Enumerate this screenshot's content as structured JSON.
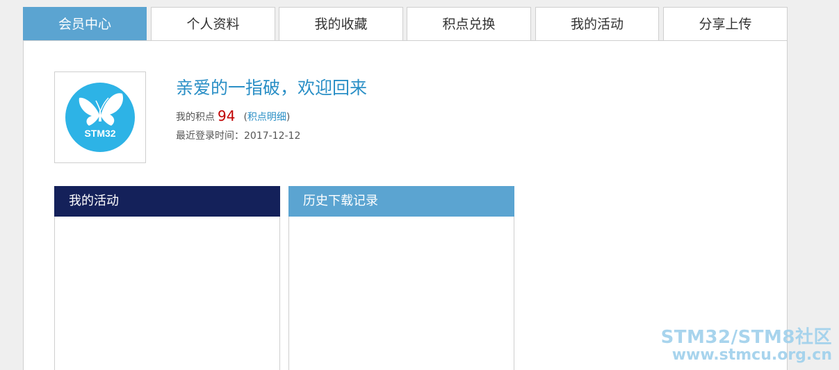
{
  "tabs": [
    {
      "label": "会员中心",
      "active": true
    },
    {
      "label": "个人资料",
      "active": false
    },
    {
      "label": "我的收藏",
      "active": false
    },
    {
      "label": "积点兑换",
      "active": false
    },
    {
      "label": "我的活动",
      "active": false
    },
    {
      "label": "分享上传",
      "active": false
    }
  ],
  "profile": {
    "avatar_text": "STM32",
    "welcome": "亲爱的一指破，欢迎回来",
    "points_label": "我的积点",
    "points_value": "94",
    "points_detail_link": "积点明细",
    "last_login_label": "最近登录时间：",
    "last_login_value": "2017-12-12"
  },
  "panels": {
    "activities_title": "我的活动",
    "downloads_title": "历史下载记录"
  },
  "watermark": {
    "line1": "STM32/STM8社区",
    "line2": "www.stmcu.org.cn"
  },
  "colors": {
    "accent": "#5ba4d1",
    "navy": "#14215a",
    "link": "#2a8fc6",
    "points": "#c00000",
    "avatar_circle": "#2db3e6"
  }
}
